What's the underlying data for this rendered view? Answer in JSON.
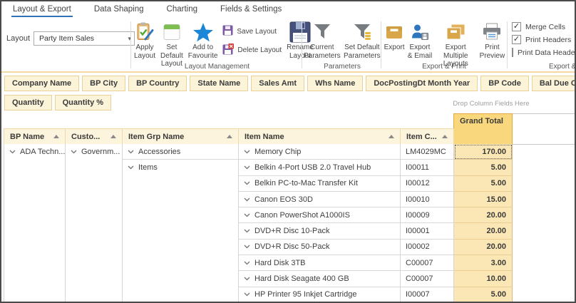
{
  "tabs": [
    {
      "label": "Layout & Export",
      "active": true
    },
    {
      "label": "Data Shaping",
      "active": false
    },
    {
      "label": "Charting",
      "active": false
    },
    {
      "label": "Fields & Settings",
      "active": false
    }
  ],
  "ribbon": {
    "layout_field": {
      "label": "Layout",
      "value": "Party Item Sales"
    },
    "layout_management": {
      "group_label": "Layout Management",
      "apply": "Apply Layout",
      "set_default": "Set Default Layout",
      "favourite": "Add to Favourite",
      "save": "Save Layout",
      "delete": "Delete Layout",
      "rename": "Rename Layout"
    },
    "parameters": {
      "group_label": "Parameters",
      "current": "Current Parameters",
      "set_default": "Set Default Parameters"
    },
    "export_print": {
      "group_label": "Export & Print",
      "export": "Export",
      "export_email": "Export & Email",
      "export_multiple": "Export Multiple Layouts",
      "print_preview": "Print Preview"
    },
    "options": {
      "group_label": "Export & F",
      "checkboxes": [
        {
          "label": "Merge Cells",
          "checked": true
        },
        {
          "label": "Print Headers",
          "checked": true
        },
        {
          "label": "Print Data Headers",
          "checked": false
        }
      ]
    }
  },
  "row_fields": [
    "Company Name",
    "BP City",
    "BP Country",
    "State Name",
    "Sales Amt",
    "Whs Name",
    "DocPostingDt Month Year",
    "BP Code",
    "Bal Due On Doc"
  ],
  "data_fields": [
    "Quantity",
    "Quantity %"
  ],
  "drop_hint": "Drop Column Fields Here",
  "pivot": {
    "grand_total_label": "Grand Total",
    "columns": {
      "bp": "BP Name",
      "customer": "Custo...",
      "item_grp": "Item Grp Name",
      "item_name": "Item Name",
      "item_code": "Item C..."
    },
    "row_groups": {
      "bp": "ADA Techn...",
      "customer": "Governm...",
      "item_grp_1": "Accessories",
      "item_grp_2": "Items"
    },
    "rows": [
      {
        "item": "Memory Chip",
        "code": "LM4029MC",
        "total": "170.00",
        "selected": true
      },
      {
        "item": "Belkin 4-Port USB 2.0 Travel Hub",
        "code": "I00011",
        "total": "5.00",
        "selected": false
      },
      {
        "item": "Belkin PC-to-Mac Transfer Kit",
        "code": "I00012",
        "total": "5.00",
        "selected": false
      },
      {
        "item": "Canon EOS 30D",
        "code": "I00010",
        "total": "15.00",
        "selected": false
      },
      {
        "item": "Canon PowerShot A1000IS",
        "code": "I00009",
        "total": "20.00",
        "selected": false
      },
      {
        "item": "DVD+R Disc 10-Pack",
        "code": "I00001",
        "total": "20.00",
        "selected": false
      },
      {
        "item": "DVD+R Disc 50-Pack",
        "code": "I00002",
        "total": "20.00",
        "selected": false
      },
      {
        "item": "Hard Disk 3TB",
        "code": "C00007",
        "total": "3.00",
        "selected": false
      },
      {
        "item": "Hard Disk Seagate 400 GB",
        "code": "C00007",
        "total": "10.00",
        "selected": false
      },
      {
        "item": "HP Printer 95 Inkjet Cartridge",
        "code": "I00007",
        "total": "5.00",
        "selected": false
      }
    ]
  },
  "colors": {
    "accent_blue": "#2E74B5",
    "chip_bg": "#FCF4D9",
    "grand_total_header_bg": "#F8D77D",
    "grand_total_cell_bg": "#FBE7B5"
  }
}
